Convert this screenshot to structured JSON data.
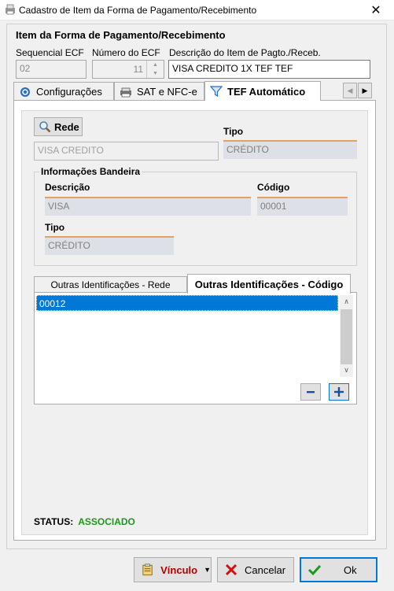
{
  "window": {
    "title": "Cadastro de Item da Forma de Pagamento/Recebimento",
    "close_glyph": "✕"
  },
  "group": {
    "title": "Item da Forma de Pagamento/Recebimento"
  },
  "fields": {
    "sequencial_label": "Sequencial ECF",
    "sequencial_value": "02",
    "numero_label": "Número do ECF",
    "numero_value": "11",
    "descricao_label": "Descrição do Item de Pagto./Receb.",
    "descricao_value": "VISA CREDITO 1X TEF TEF"
  },
  "tabs": [
    {
      "label": "Configurações",
      "icon": "gear-icon"
    },
    {
      "label": "SAT e NFC-e",
      "icon": "printer-icon"
    },
    {
      "label": "TEF Automático",
      "icon": "filter-icon",
      "active": true
    }
  ],
  "tef": {
    "rede_button": "Rede",
    "rede_value": "VISA CREDITO",
    "tipo_label": "Tipo",
    "tipo_value": "CRÉDITO",
    "bandeira_title": "Informações Bandeira",
    "descricao_label": "Descrição",
    "descricao_value": "VISA",
    "codigo_label": "Código",
    "codigo_value": "00001",
    "btipo_label": "Tipo",
    "btipo_value": "CRÉDITO"
  },
  "subtabs": [
    {
      "label": "Outras Identificações - Rede"
    },
    {
      "label": "Outras Identificações - Código",
      "active": true
    }
  ],
  "list": {
    "items": [
      "00012"
    ]
  },
  "status": {
    "label": "STATUS:",
    "value": "ASSOCIADO",
    "color": "#1a9a1a"
  },
  "buttons": {
    "vinculo": "Vínculo",
    "cancelar": "Cancelar",
    "ok": "Ok"
  }
}
